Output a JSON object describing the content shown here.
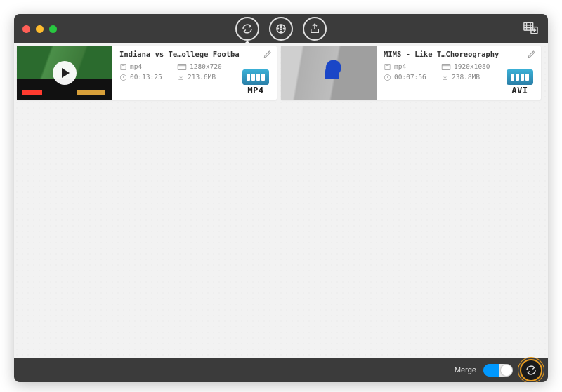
{
  "footer": {
    "merge_label": "Merge",
    "merge_on": true
  },
  "items": [
    {
      "title": "Indiana vs Te…ollege Footba",
      "container": "mp4",
      "resolution": "1280x720",
      "duration": "00:13:25",
      "size": "213.6MB",
      "output_format": "MP4",
      "output_format_color": "#2a93bf"
    },
    {
      "title": "MIMS - Like T…Choreography",
      "container": "mp4",
      "resolution": "1920x1080",
      "duration": "00:07:56",
      "size": "238.8MB",
      "output_format": "AVI",
      "output_format_color": "#2a93bf"
    }
  ]
}
